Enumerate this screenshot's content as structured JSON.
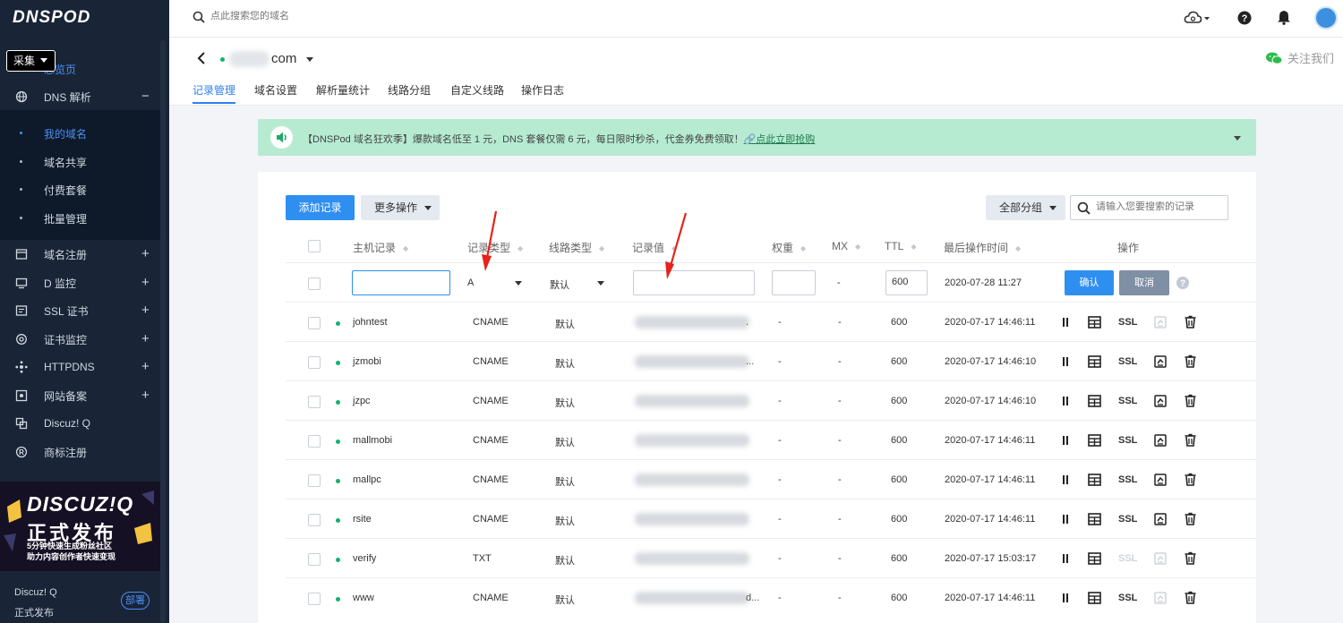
{
  "sidebar": {
    "logo": "DNSPOD",
    "tag": "采集",
    "overview": "总览页",
    "nav": [
      {
        "label": "DNS 解析",
        "sign": "−"
      },
      {
        "label": "域名注册",
        "sign": "+"
      },
      {
        "label": "D 监控",
        "sign": "+"
      },
      {
        "label": "SSL 证书",
        "sign": "+"
      },
      {
        "label": "证书监控",
        "sign": "+"
      },
      {
        "label": "HTTPDNS",
        "sign": "+"
      },
      {
        "label": "网站备案",
        "sign": "+"
      },
      {
        "label": "Discuz! Q",
        "sign": ""
      },
      {
        "label": "商标注册",
        "sign": ""
      }
    ],
    "submenu": [
      "我的域名",
      "域名共享",
      "付费套餐",
      "批量管理"
    ],
    "banner": {
      "l1": "DISCUZ!Q",
      "l2": "正式发布",
      "l3": "5分钟快速生成粉丝社区",
      "l4": "助力内容创作者快速变现"
    },
    "footer": {
      "title": "Discuz! Q",
      "sub": "正式发布",
      "collapse": "部署"
    }
  },
  "topbar": {
    "search_placeholder": "点此搜索您的域名"
  },
  "domain": {
    "name": "com",
    "follow": "关注我们"
  },
  "tabs": [
    "记录管理",
    "域名设置",
    "解析量统计",
    "线路分组",
    "自定义线路",
    "操作日志"
  ],
  "notice": {
    "text": "【DNSPod 域名狂欢季】爆款域名低至 1 元，DNS 套餐仅需 6 元，每日限时秒杀，代金券免费领取！",
    "link": "点此立即抢购"
  },
  "toolbar": {
    "add": "添加记录",
    "more": "更多操作",
    "group": "全部分组",
    "search_placeholder": "请输入您要搜索的记录"
  },
  "columns": [
    "主机记录",
    "记录类型",
    "线路类型",
    "记录值",
    "权重",
    "MX",
    "TTL",
    "最后操作时间",
    "操作"
  ],
  "edit_row": {
    "type": "A",
    "line": "默认",
    "weight": "-",
    "mx": "-",
    "ttl": "600",
    "time": "2020-07-28 11:27",
    "confirm": "确认",
    "cancel": "取消"
  },
  "records": [
    {
      "host": "johntest",
      "type": "CNAME",
      "line": "默认",
      "value": ".",
      "weight": "-",
      "mx": "-",
      "ttl": "600",
      "time": "2020-07-17 14:46:11",
      "ssl": "SSL",
      "ssl_enabled": true
    },
    {
      "host": "jzmobi",
      "type": "CNAME",
      "line": "默认",
      "value": "...",
      "weight": "-",
      "mx": "-",
      "ttl": "600",
      "time": "2020-07-17 14:46:10",
      "ssl": "SSL",
      "ssl_enabled": true
    },
    {
      "host": "jzpc",
      "type": "CNAME",
      "line": "默认",
      "value": "",
      "weight": "-",
      "mx": "-",
      "ttl": "600",
      "time": "2020-07-17 14:46:10",
      "ssl": "SSL",
      "ssl_enabled": true
    },
    {
      "host": "mallmobi",
      "type": "CNAME",
      "line": "默认",
      "value": "",
      "weight": "-",
      "mx": "-",
      "ttl": "600",
      "time": "2020-07-17 14:46:11",
      "ssl": "SSL",
      "ssl_enabled": true
    },
    {
      "host": "mallpc",
      "type": "CNAME",
      "line": "默认",
      "value": "",
      "weight": "-",
      "mx": "-",
      "ttl": "600",
      "time": "2020-07-17 14:46:11",
      "ssl": "SSL",
      "ssl_enabled": true
    },
    {
      "host": "rsite",
      "type": "CNAME",
      "line": "默认",
      "value": "",
      "weight": "-",
      "mx": "-",
      "ttl": "600",
      "time": "2020-07-17 14:46:11",
      "ssl": "SSL",
      "ssl_enabled": true
    },
    {
      "host": "verify",
      "type": "TXT",
      "line": "默认",
      "value": "",
      "weight": "-",
      "mx": "-",
      "ttl": "600",
      "time": "2020-07-17 15:03:17",
      "ssl": "SSL",
      "ssl_enabled": false
    },
    {
      "host": "www",
      "type": "CNAME",
      "line": "默认",
      "value": "d...",
      "weight": "-",
      "mx": "-",
      "ttl": "600",
      "time": "2020-07-17 14:46:11",
      "ssl": "SSL",
      "ssl_enabled": true
    }
  ],
  "colors": {
    "accent": "#2f8ff0",
    "sidebar": "#192537",
    "online": "#10b26d",
    "notice_bg": "#b6ebd2",
    "annotation": "#e5231b"
  },
  "annotations": {
    "arrows": 2,
    "color": "red"
  }
}
